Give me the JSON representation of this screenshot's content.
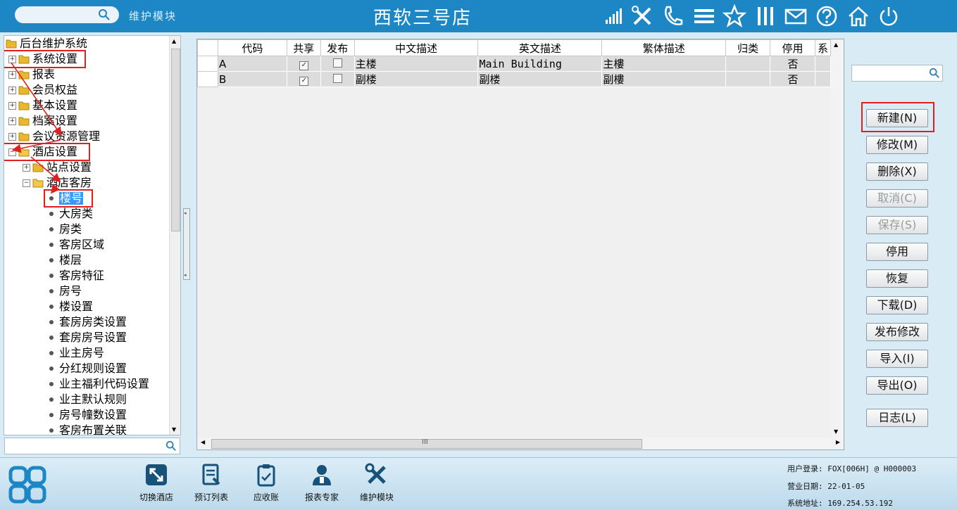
{
  "header": {
    "module_label": "维护模块",
    "store_title": "西软三号店"
  },
  "tree": {
    "nodes": [
      {
        "label": "后台维护系统"
      },
      {
        "label": "系统设置"
      },
      {
        "label": "报表"
      },
      {
        "label": "会员权益"
      },
      {
        "label": "基本设置"
      },
      {
        "label": "档案设置"
      },
      {
        "label": "会议资源管理"
      },
      {
        "label": "酒店设置"
      },
      {
        "label": "站点设置"
      },
      {
        "label": "酒店客房"
      },
      {
        "label": "楼号"
      },
      {
        "label": "大房类"
      },
      {
        "label": "房类"
      },
      {
        "label": "客房区域"
      },
      {
        "label": "楼层"
      },
      {
        "label": "客房特征"
      },
      {
        "label": "房号"
      },
      {
        "label": "楼设置"
      },
      {
        "label": "套房房类设置"
      },
      {
        "label": "套房房号设置"
      },
      {
        "label": "业主房号"
      },
      {
        "label": "分红规则设置"
      },
      {
        "label": "业主福利代码设置"
      },
      {
        "label": "业主默认规则"
      },
      {
        "label": "房号幢数设置"
      },
      {
        "label": "客房布置关联"
      }
    ]
  },
  "grid": {
    "columns": [
      "代码",
      "共享",
      "发布",
      "中文描述",
      "英文描述",
      "繁体描述",
      "归类",
      "停用",
      "系"
    ],
    "rows": [
      {
        "code": "A",
        "shared": true,
        "published": false,
        "zh": "主楼",
        "en": "Main Building",
        "tw": "主樓",
        "category": "",
        "disabled": "否"
      },
      {
        "code": "B",
        "shared": true,
        "published": false,
        "zh": "副楼",
        "en": "副楼",
        "tw": "副樓",
        "category": "",
        "disabled": "否"
      }
    ],
    "hscroll_marker": "III"
  },
  "actions": {
    "new": "新建(N)",
    "modify": "修改(M)",
    "delete": "删除(X)",
    "cancel": "取消(C)",
    "save": "保存(S)",
    "disable": "停用",
    "restore": "恢复",
    "download": "下载(D)",
    "publish_modify": "发布修改",
    "import": "导入(I)",
    "export": "导出(O)",
    "log": "日志(L)"
  },
  "bottom": {
    "tools": [
      "切换酒店",
      "预订列表",
      "应收账",
      "报表专家",
      "维护模块"
    ],
    "user_login": "用户登录: FOX[006H] @ H000003",
    "business_date": "营业日期: 22-01-05",
    "system_address": "系统地址: 169.254.53.192"
  },
  "colors": {
    "header_bg": "#1d87c6",
    "highlight": "#e02020",
    "row_bg": "#dcdcdc"
  }
}
